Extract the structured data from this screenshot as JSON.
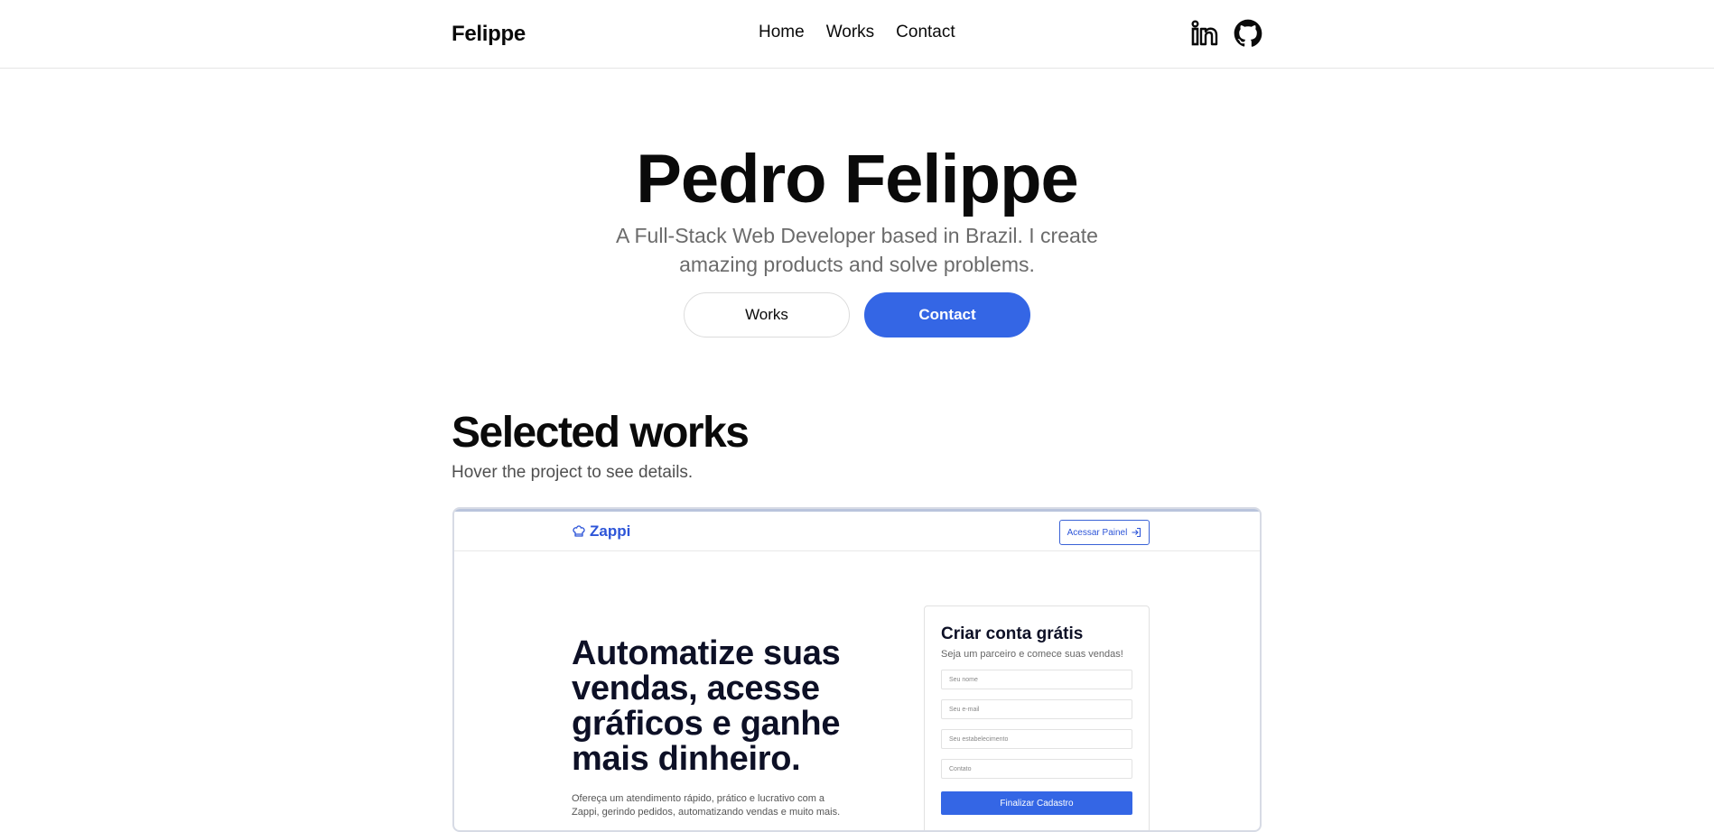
{
  "header": {
    "brand": "Felippe",
    "nav": [
      {
        "label": "Home"
      },
      {
        "label": "Works"
      },
      {
        "label": "Contact"
      }
    ],
    "socials": [
      {
        "icon": "linkedin-icon"
      },
      {
        "icon": "github-icon"
      }
    ]
  },
  "hero": {
    "title": "Pedro Felippe",
    "subtitle": "A Full-Stack Web Developer based in Brazil. I create amazing products and solve problems.",
    "works_button": "Works",
    "contact_button": "Contact"
  },
  "works": {
    "title": "Selected works",
    "subtitle": "Hover the project to see details.",
    "project": {
      "logo": "Zappi",
      "header_button": "Acessar Painel",
      "headline": "Automatize suas vendas, acesse gráficos e ganhe mais dinheiro.",
      "paragraph": "Ofereça um atendimento rápido, prático e lucrativo com a Zappi, gerindo pedidos, automatizando vendas e muito mais.",
      "form": {
        "title": "Criar conta grátis",
        "subtitle": "Seja um parceiro e comece suas vendas!",
        "fields": [
          {
            "placeholder": "Seu nome"
          },
          {
            "placeholder": "Seu e-mail"
          },
          {
            "placeholder": "Seu estabelecimento"
          },
          {
            "placeholder": "Contato"
          }
        ],
        "submit": "Finalizar Cadastro"
      }
    }
  },
  "colors": {
    "accent": "#3466e5",
    "text": "#0a0a0a",
    "muted": "#6b6b6b"
  }
}
